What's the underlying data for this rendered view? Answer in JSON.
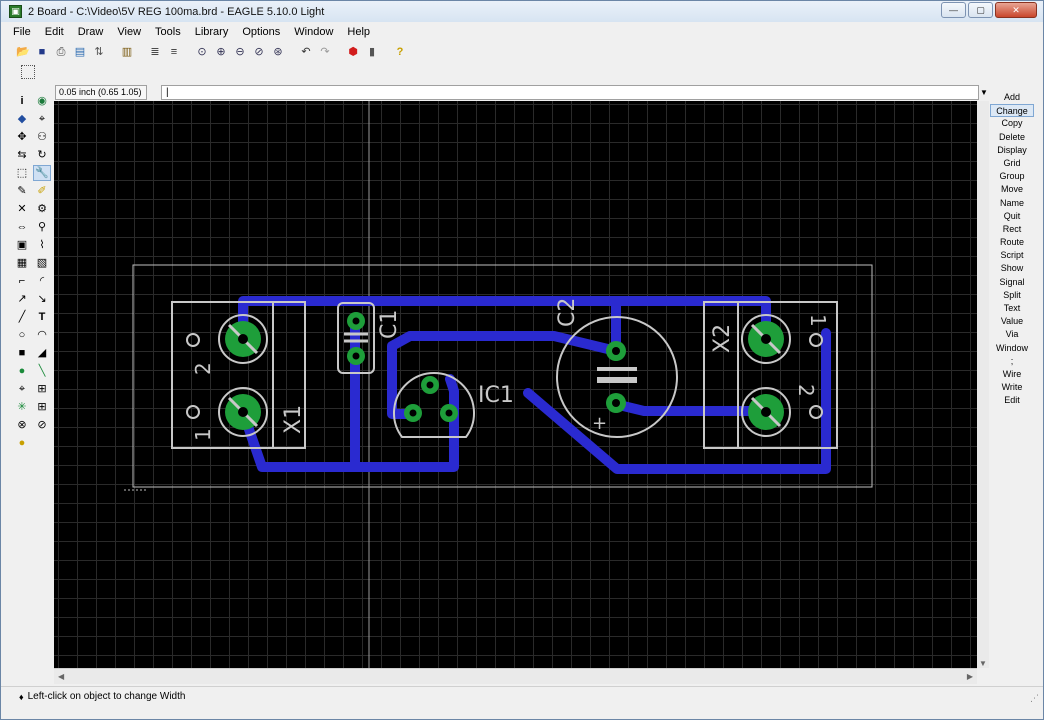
{
  "window": {
    "title": "2 Board - C:\\Video\\5V REG 100ma.brd - EAGLE 5.10.0 Light",
    "minimize": "—",
    "maximize": "▢",
    "close": "✕"
  },
  "menu": [
    "File",
    "Edit",
    "Draw",
    "View",
    "Tools",
    "Library",
    "Options",
    "Window",
    "Help"
  ],
  "command_line": {
    "coordinate": "0.05 inch (0.65 1.05)",
    "value": "|"
  },
  "commands": [
    "Add",
    "Change",
    "Copy",
    "Delete",
    "Display",
    "Grid",
    "Group",
    "Move",
    "Name",
    "Quit",
    "Rect",
    "Route",
    "Script",
    "Show",
    "Signal",
    "Split",
    "Text",
    "Value",
    "Via",
    "Window",
    ";",
    "Wire",
    "Write",
    "Edit"
  ],
  "active_command": "Change",
  "status": {
    "bullet": "♦",
    "message": "Left-click on object to change Width"
  },
  "board": {
    "parts": {
      "x1": "X1",
      "x2": "X2",
      "c1": "C1",
      "c2": "C2",
      "ic1": "IC1",
      "x1_pin1": "1",
      "x1_pin2": "2",
      "x2_pin1": "1",
      "x2_pin2": "2",
      "c2_plus": "+"
    },
    "colors": {
      "trace": "#2a2ad0",
      "pad": "#1e9e3a",
      "silk": "#c8c8c8",
      "outline": "#bfbfbf"
    }
  }
}
